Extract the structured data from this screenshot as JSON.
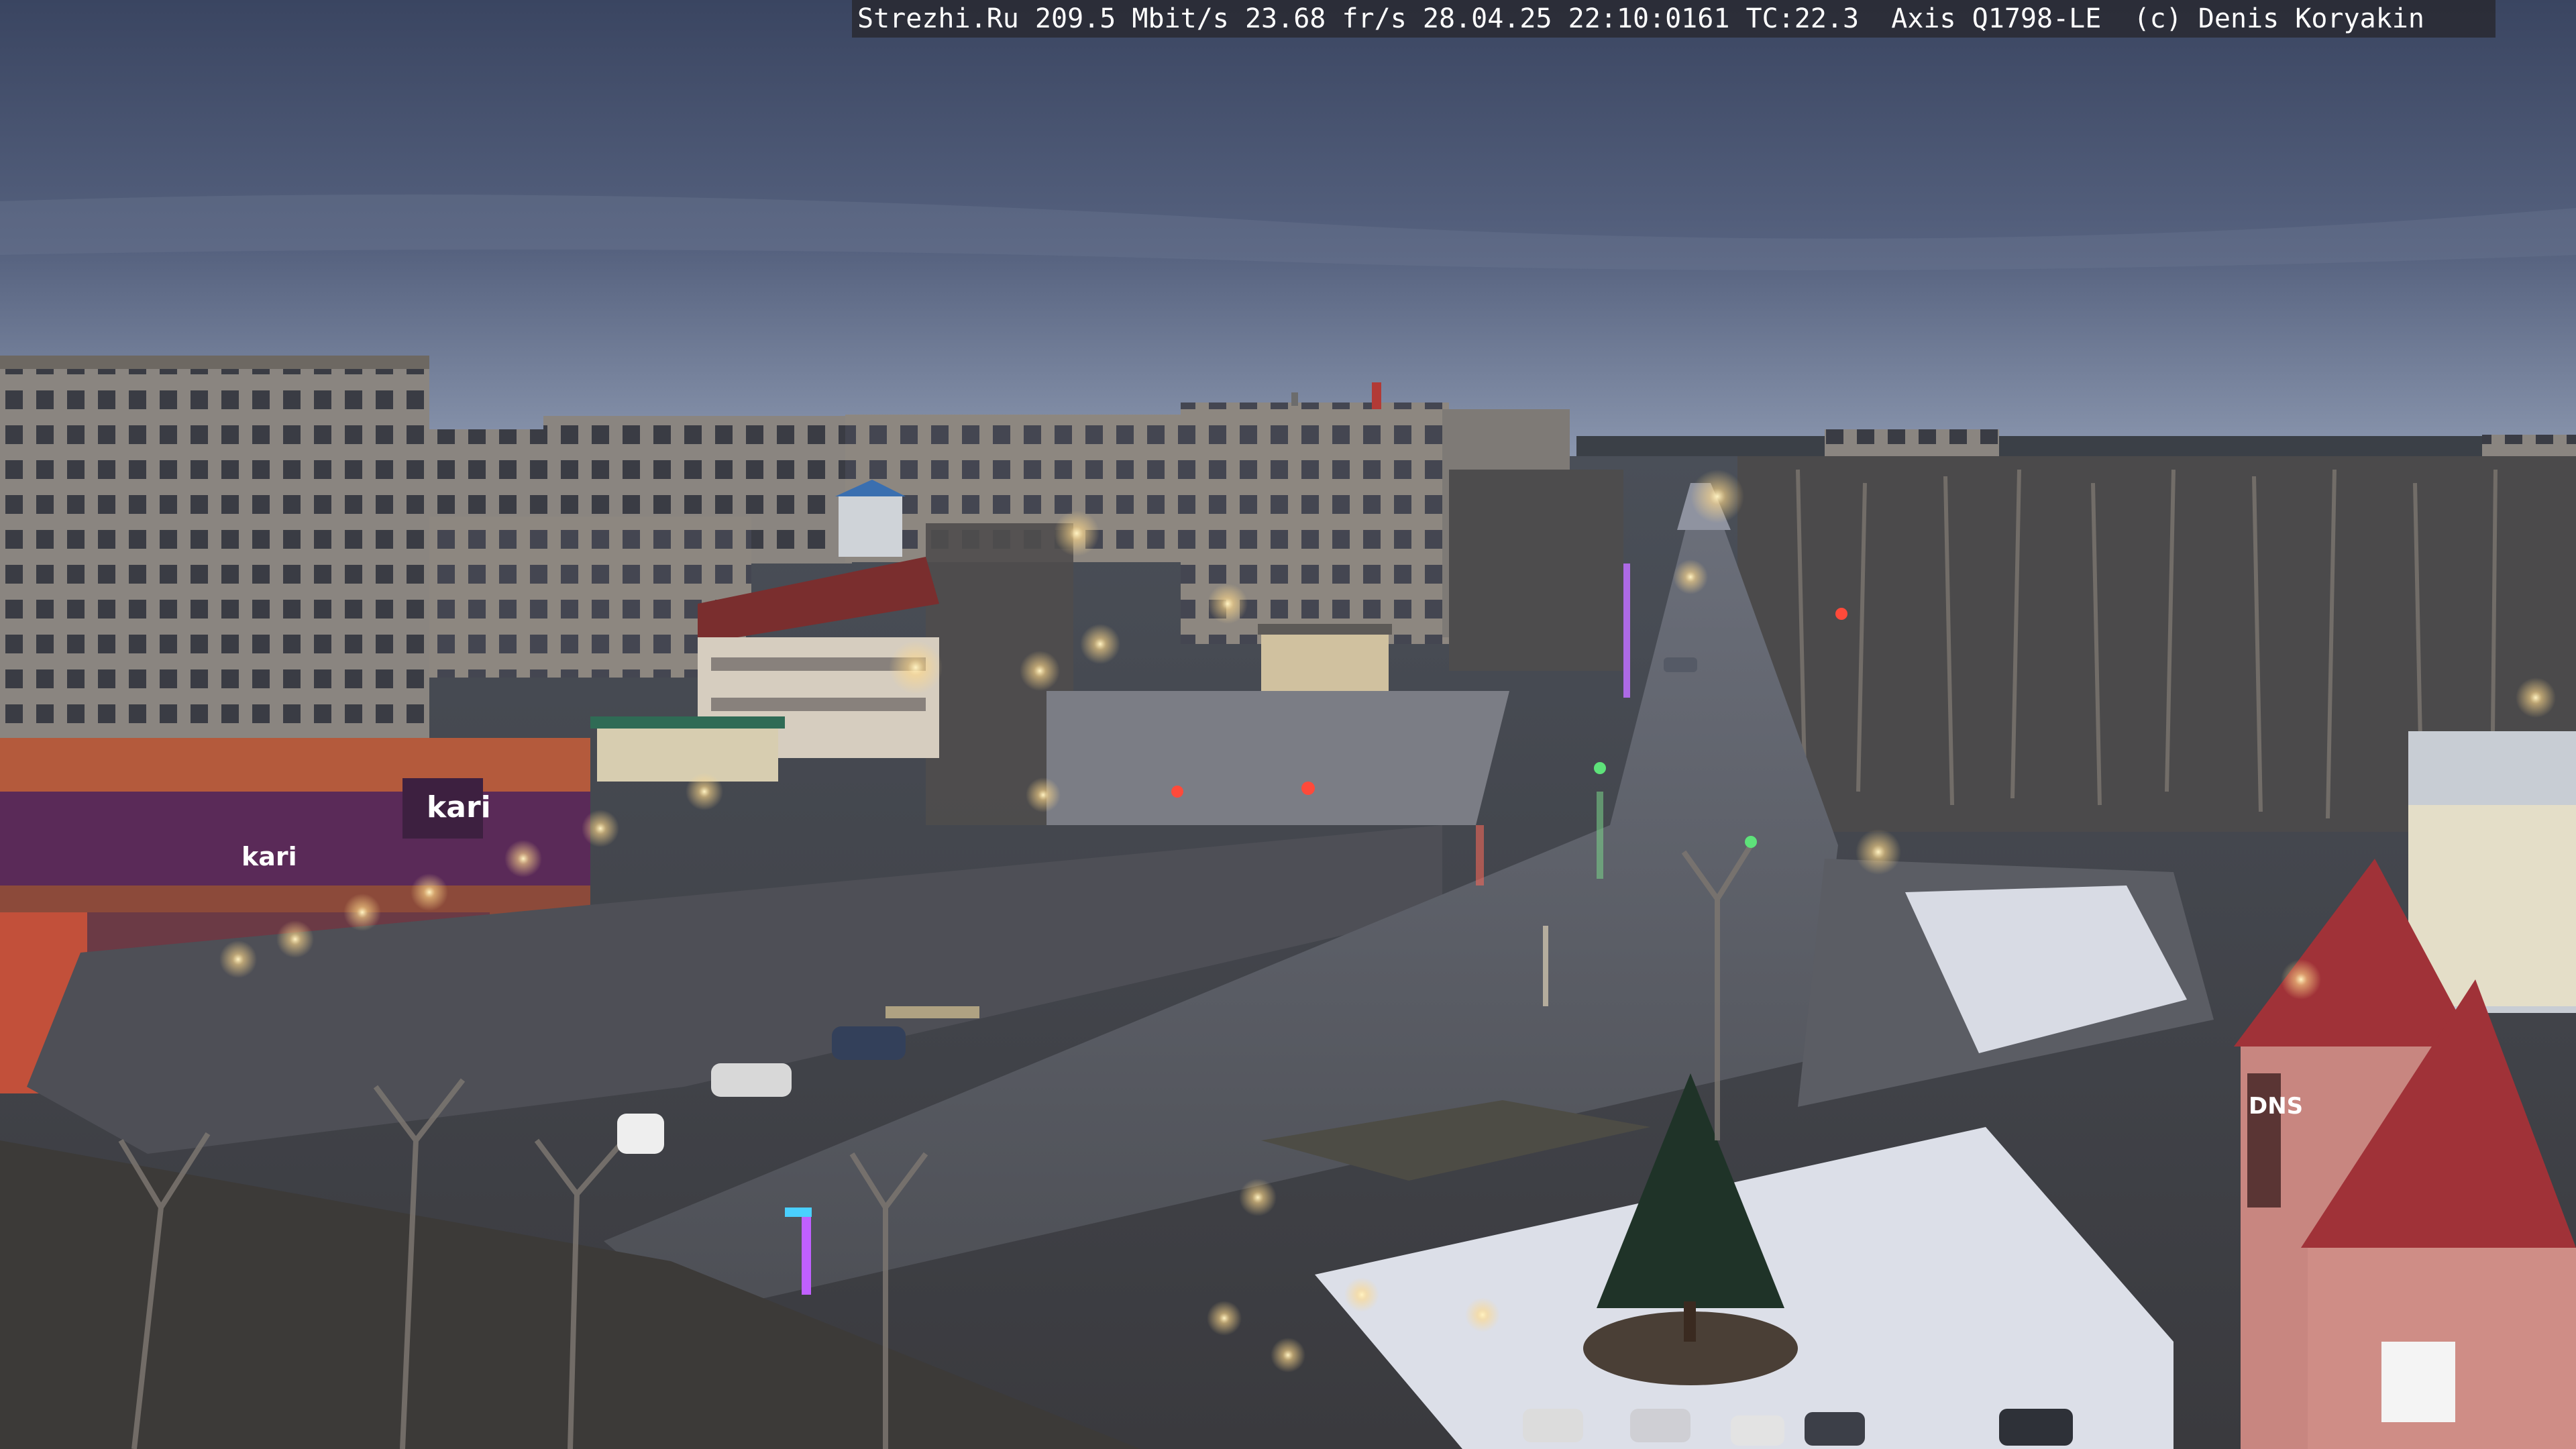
{
  "overlay": {
    "text": "Strezhi.Ru 209.5 Mbit/s 23.68 fr/s 28.04.25 22:10:0161 TC:22.3  Axis Q1798-LE  (c) Denis Koryakin"
  },
  "signs": {
    "shop_left": "kari",
    "shop_left_small": "kari",
    "dns": "DNS"
  },
  "colors": {
    "sky_top": "#3c4763",
    "sky_bottom": "#8d9ab3",
    "accent_red": "#a5363a",
    "signage_purple": "#5a2a58",
    "street_light": "#ffe7a8"
  }
}
